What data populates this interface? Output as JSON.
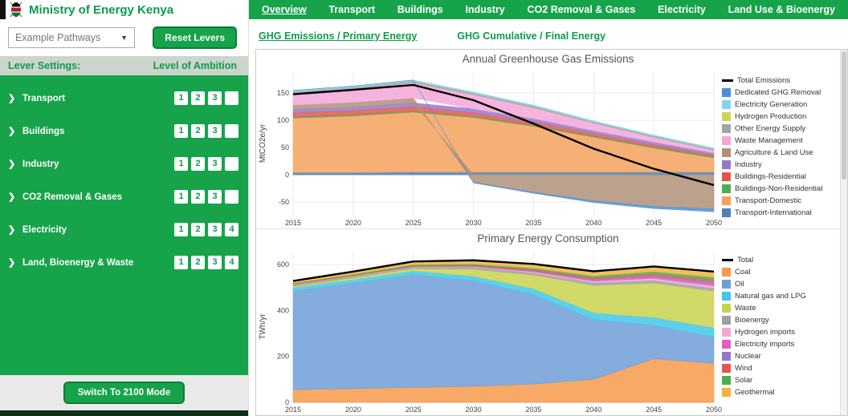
{
  "colors": {
    "accent_green": "#16a34a",
    "dark_green_border": "#0e7c39",
    "header_text_green": "#0c9c4c"
  },
  "icons": {
    "dropdown_arrow": "▼",
    "chevron_right": "❯"
  },
  "sidebar": {
    "title": "Ministry of Energy Kenya",
    "pathways_select": "Example Pathways",
    "reset_button": "Reset Levers",
    "settings_header": "Lever Settings:",
    "ambition_header": "Level of Ambition",
    "levers": [
      {
        "label": "Transport",
        "buttons": [
          "1",
          "2",
          "3",
          ""
        ]
      },
      {
        "label": "Buildings",
        "buttons": [
          "1",
          "2",
          "3",
          ""
        ]
      },
      {
        "label": "Industry",
        "buttons": [
          "1",
          "2",
          "3",
          ""
        ]
      },
      {
        "label": "CO2 Removal & Gases",
        "buttons": [
          "1",
          "2",
          "3",
          ""
        ]
      },
      {
        "label": "Electricity",
        "buttons": [
          "1",
          "2",
          "3",
          "4"
        ]
      },
      {
        "label": "Land, Bioenergy & Waste",
        "buttons": [
          "1",
          "2",
          "3",
          "4"
        ]
      }
    ],
    "mode_button": "Switch To 2100 Mode"
  },
  "nav": {
    "items": [
      {
        "label": "Overview",
        "active": true
      },
      {
        "label": "Transport",
        "active": false
      },
      {
        "label": "Buildings",
        "active": false
      },
      {
        "label": "Industry",
        "active": false
      },
      {
        "label": "CO2 Removal & Gases",
        "active": false
      },
      {
        "label": "Electricity",
        "active": false
      },
      {
        "label": "Land Use & Bioenergy",
        "active": false
      }
    ]
  },
  "subtabs": [
    {
      "label": "GHG Emissions / Primary Energy",
      "active": true
    },
    {
      "label": "GHG Cumulative / Final Energy",
      "active": false
    }
  ],
  "chart_data": [
    {
      "type": "area",
      "title": "Annual Greenhouse Gas Emissions",
      "ylabel": "MtCO2e/yr",
      "x": [
        2015,
        2020,
        2025,
        2030,
        2035,
        2040,
        2045,
        2050
      ],
      "ylim": [
        -75,
        190
      ],
      "yticks": [
        -50,
        0,
        50,
        100,
        150
      ],
      "grid": true,
      "legend_position": "right",
      "series": [
        {
          "name": "transport-international",
          "color": "#4f81b8",
          "values": [
            4,
            4,
            5,
            5,
            5,
            5,
            5,
            5
          ]
        },
        {
          "name": "transport-domestic",
          "color": "#f5a25d",
          "values": [
            100,
            104,
            110,
            100,
            84,
            64,
            44,
            26
          ]
        },
        {
          "name": "buildings-non-residential",
          "color": "#4bae4f",
          "values": [
            2,
            2,
            2,
            2,
            2,
            2,
            2,
            2
          ]
        },
        {
          "name": "buildings-residential",
          "color": "#e2574c",
          "values": [
            8,
            8,
            8,
            7,
            6,
            5,
            4,
            3
          ]
        },
        {
          "name": "industry",
          "color": "#9678c8",
          "values": [
            6,
            6,
            7,
            7,
            6,
            5,
            5,
            4
          ]
        },
        {
          "name": "agriculture-land-use",
          "color": "#b09178",
          "values": [
            8,
            9,
            9,
            -14,
            -32,
            -48,
            -58,
            -63
          ]
        },
        {
          "name": "waste-management",
          "color": "#f2a7d8",
          "values": [
            22,
            25,
            28,
            26,
            20,
            14,
            9,
            5
          ]
        },
        {
          "name": "other-energy-supply",
          "color": "#a3a3a3",
          "values": [
            3,
            3,
            3,
            3,
            3,
            2,
            2,
            2
          ]
        },
        {
          "name": "hydrogen-production",
          "color": "#ccd64f",
          "values": [
            0,
            0,
            0,
            0,
            0,
            0,
            0,
            0
          ]
        },
        {
          "name": "electricity-generation",
          "color": "#7fd4ef",
          "values": [
            2,
            2,
            2,
            2,
            2,
            2,
            2,
            2
          ]
        },
        {
          "name": "dedicated-ghg-removal",
          "color": "#4a90d9",
          "values": [
            0,
            0,
            0,
            -1,
            -2,
            -3,
            -4,
            -5
          ]
        }
      ],
      "total": {
        "name": "Total Emissions",
        "color": "#000000",
        "values": [
          148,
          156,
          165,
          137,
          94,
          48,
          11,
          -19
        ]
      },
      "legend": [
        {
          "label": "Total Emissions",
          "color": "#000000",
          "type": "line"
        },
        {
          "label": "Dedicated GHG Removal",
          "color": "#4a90d9",
          "type": "box"
        },
        {
          "label": "Electricity Generation",
          "color": "#7fd4ef",
          "type": "box"
        },
        {
          "label": "Hydrogen Production",
          "color": "#ccd64f",
          "type": "box"
        },
        {
          "label": "Other Energy Supply",
          "color": "#a3a3a3",
          "type": "box"
        },
        {
          "label": "Waste Management",
          "color": "#f2a7d8",
          "type": "box"
        },
        {
          "label": "Agriculture & Land Use",
          "color": "#b09178",
          "type": "box"
        },
        {
          "label": "Industry",
          "color": "#9678c8",
          "type": "box"
        },
        {
          "label": "Buildings-Residential",
          "color": "#e2574c",
          "type": "box"
        },
        {
          "label": "Buildings-Non-Residential",
          "color": "#4bae4f",
          "type": "box"
        },
        {
          "label": "Transport-Domestic",
          "color": "#f5a25d",
          "type": "box"
        },
        {
          "label": "Transport-International",
          "color": "#4f81b8",
          "type": "box"
        }
      ]
    },
    {
      "type": "area",
      "title": "Primary Energy Consumption",
      "ylabel": "TWh/yr",
      "x": [
        2015,
        2020,
        2025,
        2030,
        2035,
        2040,
        2045,
        2050
      ],
      "ylim": [
        0,
        660
      ],
      "yticks": [
        0,
        200,
        400,
        600
      ],
      "grid": true,
      "legend_position": "right",
      "series": [
        {
          "name": "coal",
          "color": "#f79a4b",
          "values": [
            55,
            60,
            65,
            70,
            80,
            100,
            190,
            170
          ]
        },
        {
          "name": "oil",
          "color": "#6f9ed6",
          "values": [
            430,
            460,
            490,
            460,
            390,
            260,
            145,
            115
          ]
        },
        {
          "name": "natural-gas-and-lpg",
          "color": "#3fc8e8",
          "values": [
            15,
            15,
            18,
            20,
            25,
            30,
            35,
            40
          ]
        },
        {
          "name": "waste",
          "color": "#c9d44d",
          "values": [
            5,
            8,
            10,
            30,
            60,
            120,
            150,
            160
          ]
        },
        {
          "name": "bioenergy",
          "color": "#a0a0a0",
          "values": [
            10,
            10,
            10,
            10,
            10,
            12,
            12,
            12
          ]
        },
        {
          "name": "hydrogen-imports",
          "color": "#f2a7d8",
          "values": [
            0,
            0,
            0,
            2,
            4,
            6,
            8,
            10
          ]
        },
        {
          "name": "electricity-imports",
          "color": "#e85bbf",
          "values": [
            0,
            0,
            0,
            2,
            3,
            5,
            6,
            8
          ]
        },
        {
          "name": "nuclear",
          "color": "#9678c8",
          "values": [
            0,
            0,
            0,
            0,
            2,
            4,
            6,
            8
          ]
        },
        {
          "name": "wind",
          "color": "#e2574c",
          "values": [
            2,
            2,
            3,
            4,
            5,
            6,
            8,
            10
          ]
        },
        {
          "name": "solar",
          "color": "#4bae4f",
          "values": [
            2,
            3,
            4,
            5,
            6,
            8,
            10,
            12
          ]
        },
        {
          "name": "geothermal",
          "color": "#f0b43e",
          "values": [
            10,
            12,
            14,
            16,
            18,
            20,
            22,
            25
          ]
        }
      ],
      "total": {
        "name": "Total",
        "color": "#000000",
        "values": [
          529,
          570,
          614,
          619,
          603,
          571,
          592,
          570
        ]
      },
      "legend": [
        {
          "label": "Total",
          "color": "#000000",
          "type": "line"
        },
        {
          "label": "Coal",
          "color": "#f79a4b",
          "type": "box"
        },
        {
          "label": "Oil",
          "color": "#6f9ed6",
          "type": "box"
        },
        {
          "label": "Natural gas and LPG",
          "color": "#3fc8e8",
          "type": "box"
        },
        {
          "label": "Waste",
          "color": "#c9d44d",
          "type": "box"
        },
        {
          "label": "Bioenergy",
          "color": "#a0a0a0",
          "type": "box"
        },
        {
          "label": "Hydrogen imports",
          "color": "#f2a7d8",
          "type": "box"
        },
        {
          "label": "Electricity imports",
          "color": "#e85bbf",
          "type": "box"
        },
        {
          "label": "Nuclear",
          "color": "#9678c8",
          "type": "box"
        },
        {
          "label": "Wind",
          "color": "#e2574c",
          "type": "box"
        },
        {
          "label": "Solar",
          "color": "#4bae4f",
          "type": "box"
        },
        {
          "label": "Geothermal",
          "color": "#f0b43e",
          "type": "box"
        }
      ]
    }
  ]
}
